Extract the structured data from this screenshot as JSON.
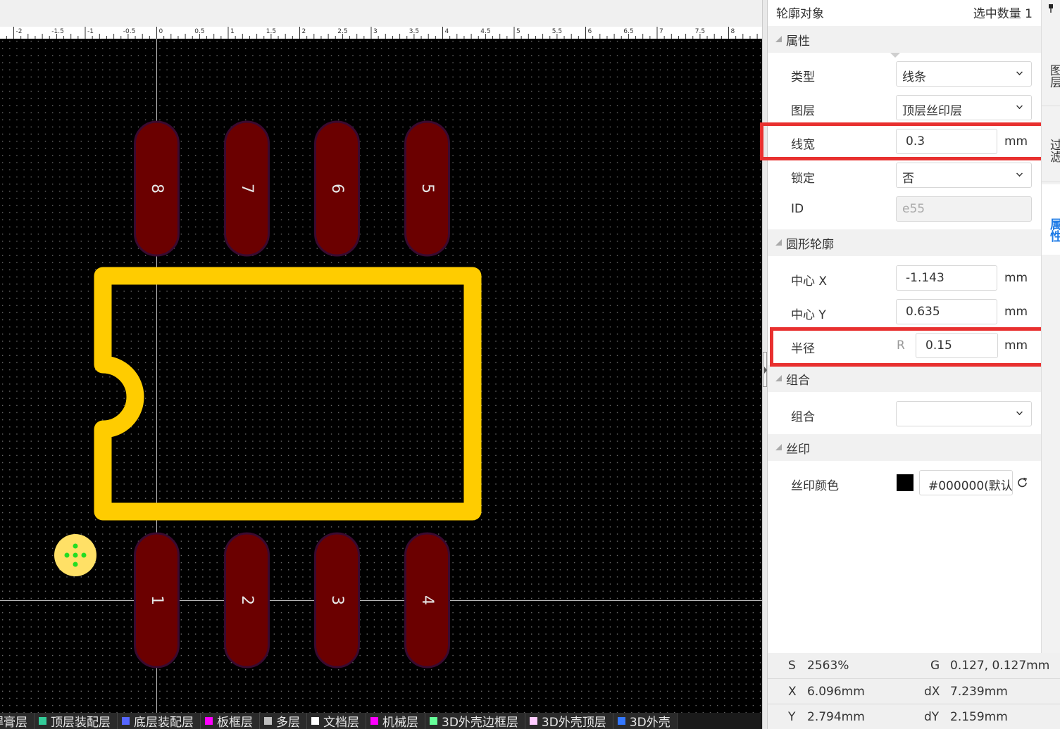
{
  "ruler": {
    "labels": [
      "-2",
      "-1.5",
      "-1",
      "-0.5",
      "0",
      "0.5",
      "1",
      "1.5",
      "2",
      "2.5",
      "3",
      "3.5",
      "4",
      "4.5",
      "5",
      "5.5",
      "6",
      "6.5",
      "7",
      "7.5",
      "8"
    ]
  },
  "pads": {
    "top": [
      "8",
      "7",
      "6",
      "5"
    ],
    "bottom": [
      "1",
      "2",
      "3",
      "4"
    ]
  },
  "layers": [
    {
      "label": "焊膏层",
      "color": "#888888"
    },
    {
      "label": "顶层装配层",
      "color": "#33cc99"
    },
    {
      "label": "底层装配层",
      "color": "#5566ff"
    },
    {
      "label": "板框层",
      "color": "#ff00ff"
    },
    {
      "label": "多层",
      "color": "#c0c0c0"
    },
    {
      "label": "文档层",
      "color": "#ffffff"
    },
    {
      "label": "机械层",
      "color": "#ff00ff"
    },
    {
      "label": "3D外壳边框层",
      "color": "#66ff99"
    },
    {
      "label": "3D外壳顶层",
      "color": "#ffccff"
    },
    {
      "label": "3D外壳",
      "color": "#3377ff"
    }
  ],
  "panel": {
    "title": "轮廓对象",
    "selected_count": "选中数量 1",
    "sections": {
      "attributes": "属性",
      "circle": "圆形轮廓",
      "group": "组合",
      "silk": "丝印"
    },
    "fields": {
      "type_label": "类型",
      "type_value": "线条",
      "layer_label": "图层",
      "layer_value": "顶层丝印层",
      "width_label": "线宽",
      "width_value": "0.3",
      "width_unit": "mm",
      "lock_label": "锁定",
      "lock_value": "否",
      "id_label": "ID",
      "id_value": "e55",
      "cx_label": "中心 X",
      "cx_value": "-1.143",
      "cx_unit": "mm",
      "cy_label": "中心 Y",
      "cy_value": "0.635",
      "cy_unit": "mm",
      "radius_label": "半径",
      "radius_prefix": "R",
      "radius_value": "0.15",
      "radius_unit": "mm",
      "group_label": "组合",
      "group_value": "",
      "silk_color_label": "丝印颜色",
      "silk_color_value": "#000000(默认",
      "silk_color_swatch": "#000000"
    }
  },
  "side_tabs": [
    "图层",
    "过滤",
    "属性"
  ],
  "status": {
    "s_label": "S",
    "s_value": "2563%",
    "g_label": "G",
    "g_value": "0.127, 0.127mm",
    "x_label": "X",
    "x_value": "6.096mm",
    "dx_label": "dX",
    "dx_value": "7.239mm",
    "y_label": "Y",
    "y_value": "2.794mm",
    "dy_label": "dY",
    "dy_value": "2.159mm"
  },
  "colors": {
    "canvas_bg": "#000000",
    "pad_fill": "#6b0000",
    "silkscreen": "#ffcc00",
    "origin_marker": "#ffe066",
    "highlight": "#e8302f",
    "active_tab": "#1e7be6"
  }
}
